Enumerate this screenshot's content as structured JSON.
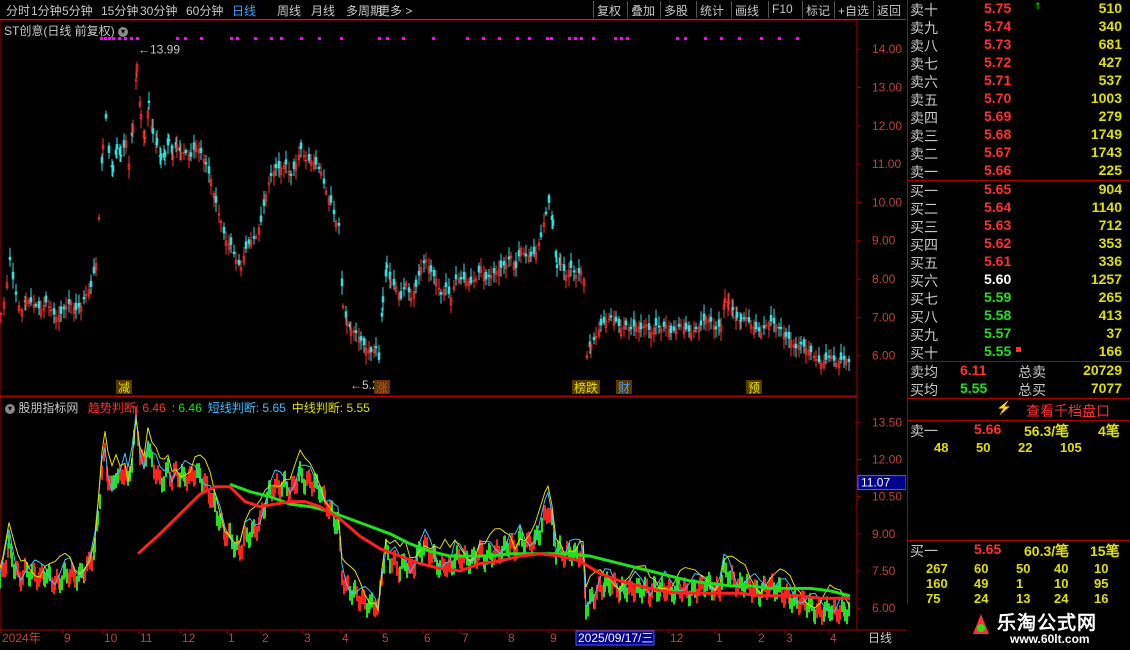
{
  "toolbar": {
    "left_items": [
      "分时",
      "1分钟",
      "5分钟",
      "15分钟",
      "30分钟",
      "60分钟",
      "日线",
      "周线",
      "月线",
      "多周期",
      "更多 >"
    ],
    "active_index": 6,
    "right_items": [
      "复权",
      "叠加",
      "多股",
      "统计",
      "画线",
      "F10",
      "标记",
      "+自选",
      "返回"
    ]
  },
  "main_chart": {
    "title": "ST创意(日线 前复权)",
    "high_marker": "13.99",
    "low_marker": "5.24",
    "event_labels": [
      "减",
      "涨",
      "榜跌",
      "财",
      "预"
    ]
  },
  "indicator_panel": {
    "name": "股朋指标网",
    "items": [
      {
        "label": "趋势判断: 6.46",
        "color": "#ff3030"
      },
      {
        "label": ": 6.46",
        "color": "#20e020"
      },
      {
        "label": "短线判断: 5.65",
        "color": "#40c0ff"
      },
      {
        "label": "中线判断: 5.55",
        "color": "#e0e000"
      }
    ],
    "cursor_value": "11.07"
  },
  "x_axis": {
    "labels": [
      "2024年",
      "9",
      "10",
      "11",
      "12",
      "1",
      "2",
      "3",
      "4",
      "5",
      "6",
      "7",
      "8",
      "9",
      "2025/09/17/三",
      "12",
      "1",
      "2",
      "3",
      "4"
    ],
    "right_label": "日线"
  },
  "chart_data": {
    "type": "candlestick",
    "title": "ST创意(日线 前复权)",
    "price_axis_main": {
      "ticks": [
        14.0,
        13.0,
        12.0,
        11.0,
        10.0,
        9.0,
        8.0,
        7.0,
        6.0
      ],
      "ylim": [
        5.0,
        14.5
      ]
    },
    "price_axis_indicator": {
      "ticks": [
        13.5,
        12.0,
        10.5,
        9.0,
        7.5,
        6.0
      ],
      "ylim": [
        5.2,
        14.2
      ]
    },
    "close_path": [
      [
        0,
        7.1
      ],
      [
        3,
        7.4
      ],
      [
        6,
        7.9
      ],
      [
        9,
        8.5
      ],
      [
        12,
        8.0
      ],
      [
        15,
        7.6
      ],
      [
        18,
        7.3
      ],
      [
        21,
        7.2
      ],
      [
        25,
        7.5
      ],
      [
        30,
        7.4
      ],
      [
        35,
        7.3
      ],
      [
        40,
        7.2
      ],
      [
        45,
        7.4
      ],
      [
        50,
        7.2
      ],
      [
        55,
        7.0
      ],
      [
        60,
        7.1
      ],
      [
        65,
        7.3
      ],
      [
        70,
        7.4
      ],
      [
        75,
        7.2
      ],
      [
        80,
        7.3
      ],
      [
        85,
        7.6
      ],
      [
        90,
        7.8
      ],
      [
        95,
        8.4
      ],
      [
        98,
        9.6
      ],
      [
        102,
        11.5
      ],
      [
        105,
        12.2
      ],
      [
        108,
        11.3
      ],
      [
        112,
        10.8
      ],
      [
        116,
        11.4
      ],
      [
        120,
        11.2
      ],
      [
        125,
        11.6
      ],
      [
        128,
        11.0
      ],
      [
        132,
        12.0
      ],
      [
        136,
        13.6
      ],
      [
        140,
        12.3
      ],
      [
        144,
        11.7
      ],
      [
        148,
        12.6
      ],
      [
        152,
        11.8
      ],
      [
        156,
        11.5
      ],
      [
        160,
        11.1
      ],
      [
        164,
        11.2
      ],
      [
        168,
        11.6
      ],
      [
        172,
        11.2
      ],
      [
        176,
        11.5
      ],
      [
        180,
        11.3
      ],
      [
        185,
        11.3
      ],
      [
        190,
        11.2
      ],
      [
        195,
        11.5
      ],
      [
        200,
        11.3
      ],
      [
        205,
        11.0
      ],
      [
        210,
        10.6
      ],
      [
        215,
        10.0
      ],
      [
        220,
        9.5
      ],
      [
        225,
        9.0
      ],
      [
        230,
        8.9
      ],
      [
        235,
        8.5
      ],
      [
        240,
        8.3
      ],
      [
        245,
        8.8
      ],
      [
        250,
        9.0
      ],
      [
        255,
        9.1
      ],
      [
        260,
        9.5
      ],
      [
        265,
        10.2
      ],
      [
        270,
        10.7
      ],
      [
        275,
        10.9
      ],
      [
        280,
        10.9
      ],
      [
        285,
        11.0
      ],
      [
        290,
        10.7
      ],
      [
        295,
        11.0
      ],
      [
        300,
        11.4
      ],
      [
        305,
        11.1
      ],
      [
        310,
        11.1
      ],
      [
        315,
        11.0
      ],
      [
        320,
        10.8
      ],
      [
        325,
        10.3
      ],
      [
        330,
        10.0
      ],
      [
        335,
        9.5
      ],
      [
        338,
        9.4
      ],
      [
        342,
        7.3
      ],
      [
        346,
        6.9
      ],
      [
        350,
        6.7
      ],
      [
        355,
        6.6
      ],
      [
        360,
        6.4
      ],
      [
        365,
        6.2
      ],
      [
        370,
        6.1
      ],
      [
        375,
        6.2
      ],
      [
        378,
        5.9
      ],
      [
        382,
        7.4
      ],
      [
        386,
        8.3
      ],
      [
        390,
        7.9
      ],
      [
        395,
        7.8
      ],
      [
        400,
        7.5
      ],
      [
        405,
        7.9
      ],
      [
        410,
        7.5
      ],
      [
        415,
        7.8
      ],
      [
        420,
        8.3
      ],
      [
        425,
        8.5
      ],
      [
        430,
        8.2
      ],
      [
        435,
        8.0
      ],
      [
        440,
        7.6
      ],
      [
        445,
        7.8
      ],
      [
        450,
        7.5
      ],
      [
        455,
        8.0
      ],
      [
        460,
        8.0
      ],
      [
        465,
        8.0
      ],
      [
        470,
        7.9
      ],
      [
        475,
        8.0
      ],
      [
        480,
        8.3
      ],
      [
        485,
        8.0
      ],
      [
        490,
        8.1
      ],
      [
        495,
        8.2
      ],
      [
        500,
        8.3
      ],
      [
        505,
        8.4
      ],
      [
        510,
        8.6
      ],
      [
        515,
        8.3
      ],
      [
        520,
        8.8
      ],
      [
        525,
        8.6
      ],
      [
        530,
        8.6
      ],
      [
        535,
        8.7
      ],
      [
        540,
        9.1
      ],
      [
        545,
        9.7
      ],
      [
        548,
        10.0
      ],
      [
        552,
        9.4
      ],
      [
        556,
        8.3
      ],
      [
        560,
        8.4
      ],
      [
        565,
        8.1
      ],
      [
        570,
        8.3
      ],
      [
        575,
        8.1
      ],
      [
        580,
        8.2
      ],
      [
        583,
        8.0
      ],
      [
        586,
        6.0
      ],
      [
        590,
        6.3
      ],
      [
        595,
        6.5
      ],
      [
        600,
        6.8
      ],
      [
        605,
        6.9
      ],
      [
        610,
        7.0
      ],
      [
        615,
        6.9
      ],
      [
        620,
        6.7
      ],
      [
        625,
        6.8
      ],
      [
        630,
        6.7
      ],
      [
        635,
        6.8
      ],
      [
        640,
        6.7
      ],
      [
        645,
        6.8
      ],
      [
        650,
        6.6
      ],
      [
        655,
        6.8
      ],
      [
        660,
        6.7
      ],
      [
        665,
        6.8
      ],
      [
        670,
        6.6
      ],
      [
        675,
        6.7
      ],
      [
        680,
        6.8
      ],
      [
        685,
        6.7
      ],
      [
        690,
        6.6
      ],
      [
        695,
        6.7
      ],
      [
        700,
        6.8
      ],
      [
        705,
        7.0
      ],
      [
        710,
        6.9
      ],
      [
        715,
        6.7
      ],
      [
        720,
        6.8
      ],
      [
        724,
        7.5
      ],
      [
        728,
        7.4
      ],
      [
        732,
        7.2
      ],
      [
        736,
        7.0
      ],
      [
        740,
        6.9
      ],
      [
        745,
        7.0
      ],
      [
        750,
        6.8
      ],
      [
        755,
        6.7
      ],
      [
        760,
        6.6
      ],
      [
        765,
        6.8
      ],
      [
        770,
        6.9
      ],
      [
        775,
        6.8
      ],
      [
        780,
        6.7
      ],
      [
        785,
        6.5
      ],
      [
        790,
        6.4
      ],
      [
        795,
        6.2
      ],
      [
        800,
        6.3
      ],
      [
        805,
        6.2
      ],
      [
        810,
        6.1
      ],
      [
        815,
        5.9
      ],
      [
        820,
        5.8
      ],
      [
        825,
        5.9
      ],
      [
        830,
        6.0
      ],
      [
        835,
        5.8
      ],
      [
        840,
        5.9
      ],
      [
        845,
        5.9
      ],
      [
        850,
        5.8
      ]
    ],
    "trend_line_red": [
      [
        138,
        8.2
      ],
      [
        160,
        9.0
      ],
      [
        180,
        9.8
      ],
      [
        200,
        10.6
      ],
      [
        215,
        10.9
      ],
      [
        230,
        10.9
      ],
      [
        245,
        10.3
      ],
      [
        260,
        10.1
      ],
      [
        275,
        10.2
      ],
      [
        290,
        10.3
      ],
      [
        305,
        10.3
      ],
      [
        320,
        10.1
      ],
      [
        340,
        9.6
      ],
      [
        360,
        8.9
      ],
      [
        380,
        8.4
      ],
      [
        400,
        8.1
      ],
      [
        420,
        7.8
      ],
      [
        440,
        7.6
      ],
      [
        460,
        7.5
      ],
      [
        480,
        7.8
      ],
      [
        500,
        7.9
      ],
      [
        520,
        8.1
      ],
      [
        540,
        8.2
      ],
      [
        560,
        8.1
      ],
      [
        580,
        7.9
      ],
      [
        600,
        7.4
      ],
      [
        620,
        7.1
      ],
      [
        640,
        6.9
      ],
      [
        660,
        6.7
      ],
      [
        680,
        6.6
      ],
      [
        700,
        6.6
      ],
      [
        720,
        6.6
      ],
      [
        740,
        6.6
      ],
      [
        760,
        6.5
      ],
      [
        780,
        6.5
      ],
      [
        800,
        6.5
      ],
      [
        820,
        6.4
      ],
      [
        840,
        6.4
      ],
      [
        850,
        6.4
      ]
    ],
    "trend_line_green": [
      [
        230,
        11.0
      ],
      [
        250,
        10.7
      ],
      [
        270,
        10.5
      ],
      [
        290,
        10.2
      ],
      [
        310,
        10.1
      ],
      [
        330,
        9.9
      ],
      [
        350,
        9.6
      ],
      [
        370,
        9.3
      ],
      [
        390,
        9.0
      ],
      [
        410,
        8.6
      ],
      [
        430,
        8.3
      ],
      [
        450,
        8.1
      ],
      [
        470,
        8.1
      ],
      [
        490,
        8.1
      ],
      [
        510,
        8.2
      ],
      [
        530,
        8.2
      ],
      [
        550,
        8.2
      ],
      [
        570,
        8.2
      ],
      [
        590,
        8.1
      ],
      [
        610,
        7.9
      ],
      [
        630,
        7.7
      ],
      [
        650,
        7.5
      ],
      [
        670,
        7.3
      ],
      [
        690,
        7.1
      ],
      [
        710,
        7.0
      ],
      [
        730,
        6.9
      ],
      [
        750,
        6.9
      ],
      [
        770,
        6.8
      ],
      [
        790,
        6.8
      ],
      [
        810,
        6.8
      ],
      [
        830,
        6.7
      ],
      [
        850,
        6.5
      ]
    ],
    "series": [
      {
        "name": "趋势判断",
        "color": "#ff3030"
      },
      {
        "name": "短线判断",
        "color": "#40c0ff"
      },
      {
        "name": "中线判断",
        "color": "#e0e000"
      }
    ],
    "xlabel": "",
    "ylabel": ""
  },
  "order_book": {
    "sells": [
      {
        "label": "卖十",
        "price": "5.75",
        "vol": "510",
        "color": "red",
        "mark": "up"
      },
      {
        "label": "卖九",
        "price": "5.74",
        "vol": "340",
        "color": "red"
      },
      {
        "label": "卖八",
        "price": "5.73",
        "vol": "681",
        "color": "red"
      },
      {
        "label": "卖七",
        "price": "5.72",
        "vol": "427",
        "color": "red"
      },
      {
        "label": "卖六",
        "price": "5.71",
        "vol": "537",
        "color": "red"
      },
      {
        "label": "卖五",
        "price": "5.70",
        "vol": "1003",
        "color": "red"
      },
      {
        "label": "卖四",
        "price": "5.69",
        "vol": "279",
        "color": "red"
      },
      {
        "label": "卖三",
        "price": "5.68",
        "vol": "1749",
        "color": "red"
      },
      {
        "label": "卖二",
        "price": "5.67",
        "vol": "1743",
        "color": "red"
      },
      {
        "label": "卖一",
        "price": "5.66",
        "vol": "225",
        "color": "red"
      }
    ],
    "buys": [
      {
        "label": "买一",
        "price": "5.65",
        "vol": "904",
        "color": "red"
      },
      {
        "label": "买二",
        "price": "5.64",
        "vol": "1140",
        "color": "red"
      },
      {
        "label": "买三",
        "price": "5.63",
        "vol": "712",
        "color": "red"
      },
      {
        "label": "买四",
        "price": "5.62",
        "vol": "353",
        "color": "red"
      },
      {
        "label": "买五",
        "price": "5.61",
        "vol": "336",
        "color": "red"
      },
      {
        "label": "买六",
        "price": "5.60",
        "vol": "1257",
        "color": "white"
      },
      {
        "label": "买七",
        "price": "5.59",
        "vol": "265",
        "color": "green"
      },
      {
        "label": "买八",
        "price": "5.58",
        "vol": "413",
        "color": "green"
      },
      {
        "label": "买九",
        "price": "5.57",
        "vol": "37",
        "color": "green"
      },
      {
        "label": "买十",
        "price": "5.55",
        "vol": "166",
        "color": "green",
        "mark": "dot"
      }
    ],
    "sell_avg": {
      "label": "卖均",
      "price": "6.11",
      "total_label": "总卖",
      "total": "20729"
    },
    "buy_avg": {
      "label": "买均",
      "price": "5.55",
      "total_label": "总买",
      "total": "7077"
    },
    "thousand_btn": "查看千档盘口",
    "sell1_detail": {
      "label": "卖一",
      "price": "5.66",
      "avg": "56.3/笔",
      "count": "4笔",
      "orders": [
        "48",
        "50",
        "22",
        "105"
      ]
    },
    "buy1_detail": {
      "label": "买一",
      "price": "5.65",
      "avg": "60.3/笔",
      "count": "15笔",
      "rows": [
        [
          "267",
          "60",
          "50",
          "40",
          "10"
        ],
        [
          "160",
          "49",
          "1",
          "10",
          "95"
        ],
        [
          "75",
          "24",
          "13",
          "24",
          "16"
        ]
      ]
    }
  },
  "logo": {
    "cn": "乐淘公式网",
    "url": "www.60lt.com"
  }
}
